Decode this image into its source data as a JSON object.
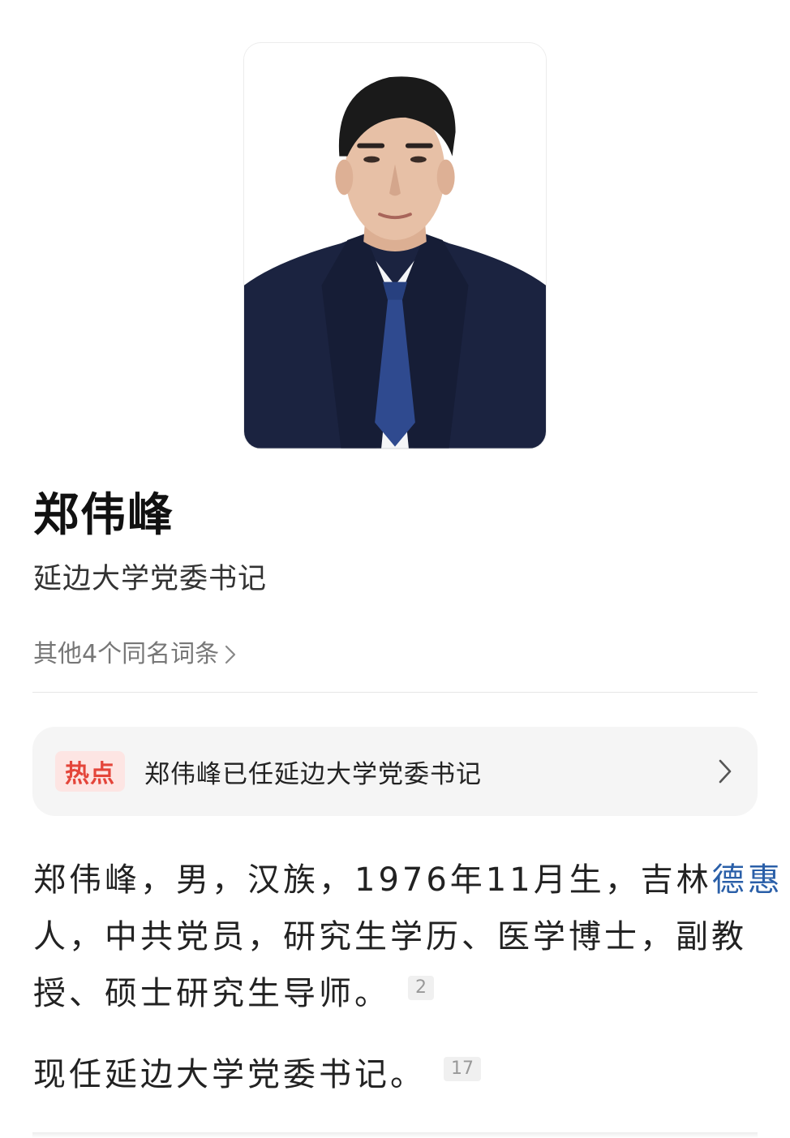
{
  "profile": {
    "name": "郑伟峰",
    "subtitle": "延边大学党委书记",
    "homonyms_label": "其他4个同名词条"
  },
  "hot": {
    "badge": "热点",
    "headline": "郑伟峰已任延边大学党委书记"
  },
  "intro": {
    "line1_a": "郑伟峰，男，汉族，1976年11月生，吉林",
    "line1_link": "德惠",
    "line2": "人，中共党员，研究生学历、医学博士，副教",
    "line3": "授、硕士研究生导师。",
    "ref1": "2",
    "line4": "现任延边大学党委书记。",
    "ref2": "17"
  },
  "colors": {
    "link": "#2a5fa8",
    "hot_badge_text": "#e4453a",
    "hot_badge_bg": "#fde5e3",
    "banner_bg": "#f5f5f5"
  },
  "icons": {
    "homonyms": "chevron-right-icon",
    "hot_banner": "chevron-right-icon"
  }
}
